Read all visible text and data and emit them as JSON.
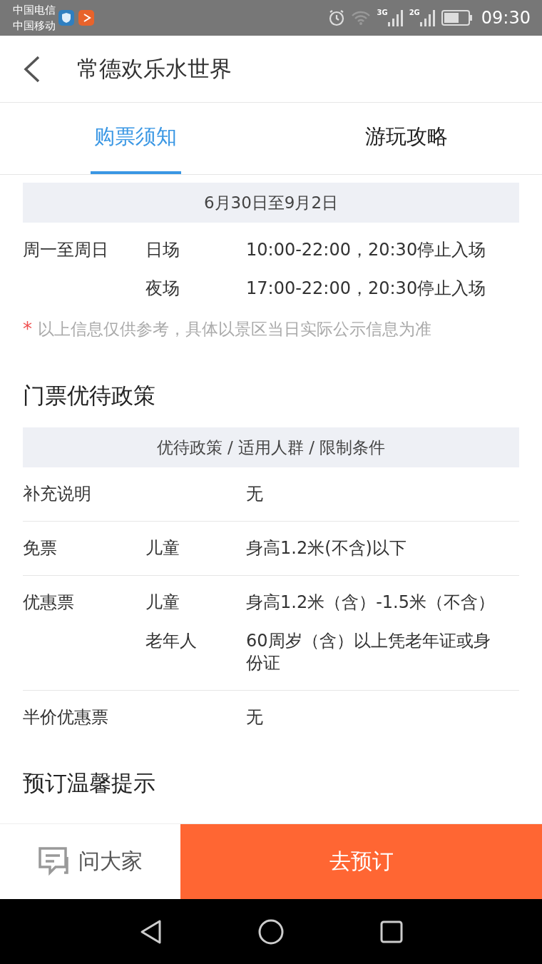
{
  "status_bar": {
    "carriers": [
      "中国电信",
      "中国移动"
    ],
    "network_labels": [
      "3G",
      "2G"
    ],
    "time": "09:30"
  },
  "header": {
    "title": "常德欢乐水世界"
  },
  "tabs": [
    {
      "label": "购票须知",
      "selected": true
    },
    {
      "label": "游玩攻略",
      "selected": false
    }
  ],
  "hours": {
    "date_range": "6月30日至9月2日",
    "rows": [
      {
        "days": "周一至周日",
        "session": "日场",
        "time": "10:00-22:00，20:30停止入场"
      },
      {
        "session": "夜场",
        "time": "17:00-22:00，20:30停止入场"
      }
    ],
    "note_mark": "*",
    "note": "以上信息仅供参考，具体以景区当日实际公示信息为准"
  },
  "policy": {
    "title": "门票优待政策",
    "header": "优待政策 / 适用人群 / 限制条件",
    "groups": [
      {
        "policy": "补充说明",
        "entries": [
          {
            "condition": "无"
          }
        ]
      },
      {
        "policy": "免票",
        "entries": [
          {
            "group": "儿童",
            "condition": "身高1.2米(不含)以下"
          }
        ]
      },
      {
        "policy": "优惠票",
        "entries": [
          {
            "group": "儿童",
            "condition": "身高1.2米（含）-1.5米（不含）"
          },
          {
            "group": "老年人",
            "condition": "60周岁（含）以上凭老年证或身份证"
          }
        ]
      },
      {
        "policy": "半价优惠票",
        "entries": [
          {
            "condition": "无"
          }
        ]
      }
    ]
  },
  "next_section": {
    "title": "预订温馨提示"
  },
  "bottom_bar": {
    "ask_label": "问大家",
    "book_label": "去预订"
  }
}
